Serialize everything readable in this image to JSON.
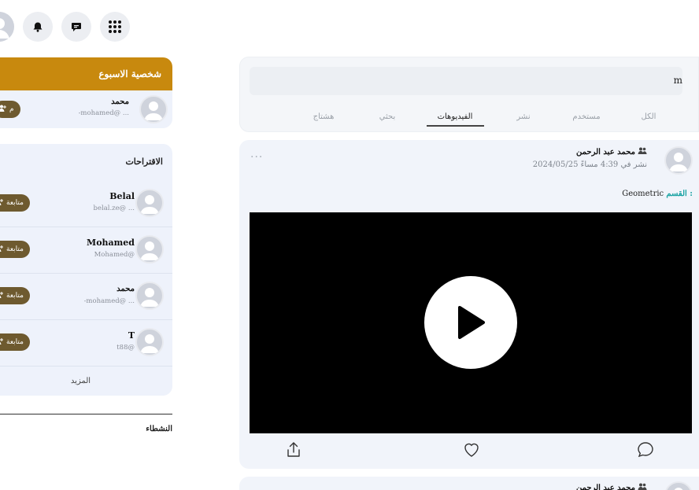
{
  "header": {
    "icons": [
      "grid-icon",
      "chat-icon",
      "bell-icon",
      "profile-avatar"
    ]
  },
  "week_personality": {
    "title": "شخصية الاسبوع",
    "user": {
      "name": "محمد",
      "handle": "-mohamed@ ...",
      "follow_label": "م"
    }
  },
  "suggestions": {
    "title": "الاقتراحات",
    "users": [
      {
        "name": "Belal",
        "handle": "belal.ze@ ...",
        "follow_label": "متابعة"
      },
      {
        "name": "Mohamed",
        "handle": "Mohamed@",
        "follow_label": "متابعة"
      },
      {
        "name": "محمد",
        "handle": "-mohamed@ ...",
        "follow_label": "متابعة"
      },
      {
        "name": "T",
        "handle": "t88@",
        "follow_label": "متابعة"
      }
    ],
    "more_label": "المزيد"
  },
  "active": {
    "title": "النشطاء"
  },
  "search": {
    "value": "m",
    "tabs": [
      {
        "label": "الكل",
        "active": false
      },
      {
        "label": "مستخدم",
        "active": false
      },
      {
        "label": "نشر",
        "active": false
      },
      {
        "label": "الفيديوهات",
        "active": true
      },
      {
        "label": "بحثي",
        "active": false
      },
      {
        "label": "هشتاج",
        "active": false
      }
    ]
  },
  "post": {
    "menu": "...",
    "author": "محمد عبد الرحمن",
    "time": "نشر في 4:39 مساءً 2024/05/25",
    "category_label": "القسم :",
    "category_value": "Geometric",
    "actions": [
      "comment-icon",
      "like-icon",
      "share-icon"
    ]
  },
  "post2": {
    "author": "محمد عبد الرحمن"
  },
  "colors": {
    "accent_gold": "#c8890e",
    "follow_button": "#6e5a2f",
    "category_teal": "#1aa3a3",
    "card_bg": "#eef2fb"
  }
}
